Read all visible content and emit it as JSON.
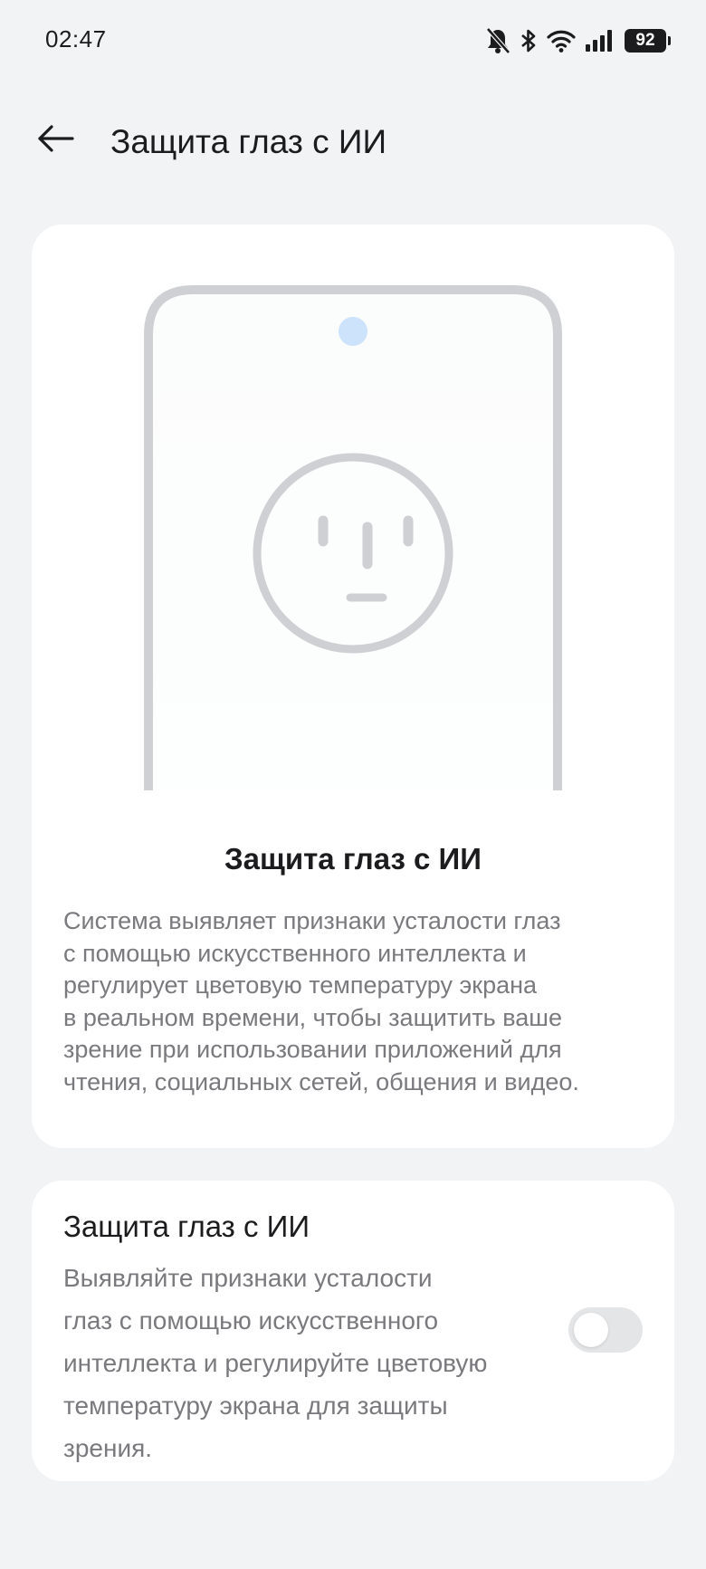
{
  "status_bar": {
    "time": "02:47",
    "battery_level": "92",
    "icons": [
      "bell-off-icon",
      "bluetooth-icon",
      "wifi-icon",
      "cellular-signal-icon",
      "battery-icon"
    ]
  },
  "header": {
    "back_icon": "arrow-left-icon",
    "title": "Защита глаз с ИИ"
  },
  "intro_card": {
    "illustration": "phone-with-face-illustration",
    "title": "Защита глаз с ИИ",
    "description_lines": [
      "Система выявляет признаки усталости глаз",
      "с помощью искусственного интеллекта и",
      "регулирует цветовую температуру экрана",
      "в реальном времени, чтобы защитить ваше",
      "зрение при использовании приложений для",
      "чтения, социальных сетей, общения и видео."
    ]
  },
  "setting_card": {
    "title": "Защита глаз с ИИ",
    "description_lines": [
      "Выявляйте признаки усталости",
      "глаз с помощью искусственного",
      "интеллекта и регулируйте цветовую",
      "температуру экрана для защиты",
      "зрения."
    ],
    "toggle_on": false
  },
  "colors": {
    "background": "#f2f3f5",
    "card": "#ffffff",
    "text_primary": "#1c1c1e",
    "text_secondary": "#7a7a7e",
    "illustration_stroke": "#cfd0d4",
    "camera_dot": "#cce3fb",
    "toggle_off": "#e4e5e7"
  }
}
